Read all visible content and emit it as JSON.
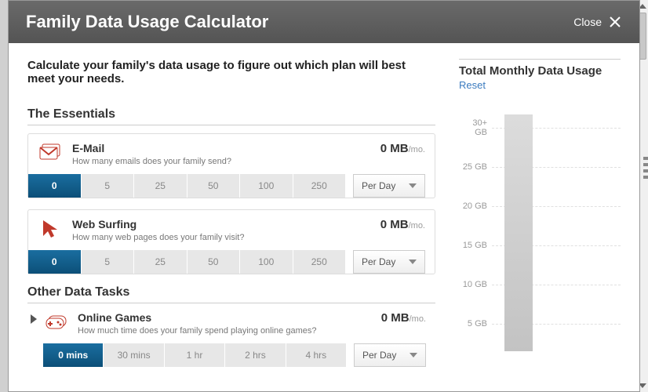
{
  "header": {
    "title": "Family Data Usage Calculator",
    "close": "Close"
  },
  "intro": "Calculate your family's data usage to figure out which plan will best meet your needs.",
  "sections": {
    "essentials": "The Essentials",
    "other": "Other Data Tasks"
  },
  "email": {
    "title": "E-Mail",
    "sub": "How many emails does your family send?",
    "usage_value": "0 MB",
    "usage_unit": "/mo.",
    "s0": "0",
    "s1": "5",
    "s2": "25",
    "s3": "50",
    "s4": "100",
    "s5": "250",
    "period": "Per Day"
  },
  "web": {
    "title": "Web Surfing",
    "sub": "How many web pages does your family visit?",
    "usage_value": "0 MB",
    "usage_unit": "/mo.",
    "s0": "0",
    "s1": "5",
    "s2": "25",
    "s3": "50",
    "s4": "100",
    "s5": "250",
    "period": "Per Day"
  },
  "games": {
    "title": "Online Games",
    "sub": "How much time does your family spend playing online games?",
    "usage_value": "0 MB",
    "usage_unit": "/mo.",
    "s0": "0 mins",
    "s1": "30 mins",
    "s2": "1 hr",
    "s3": "2 hrs",
    "s4": "4 hrs",
    "period": "Per Day"
  },
  "gauge": {
    "title": "Total Monthly Data Usage",
    "reset": "Reset",
    "t0": "30+ GB",
    "t1": "25 GB",
    "t2": "20 GB",
    "t3": "15 GB",
    "t4": "10 GB",
    "t5": "5 GB"
  }
}
